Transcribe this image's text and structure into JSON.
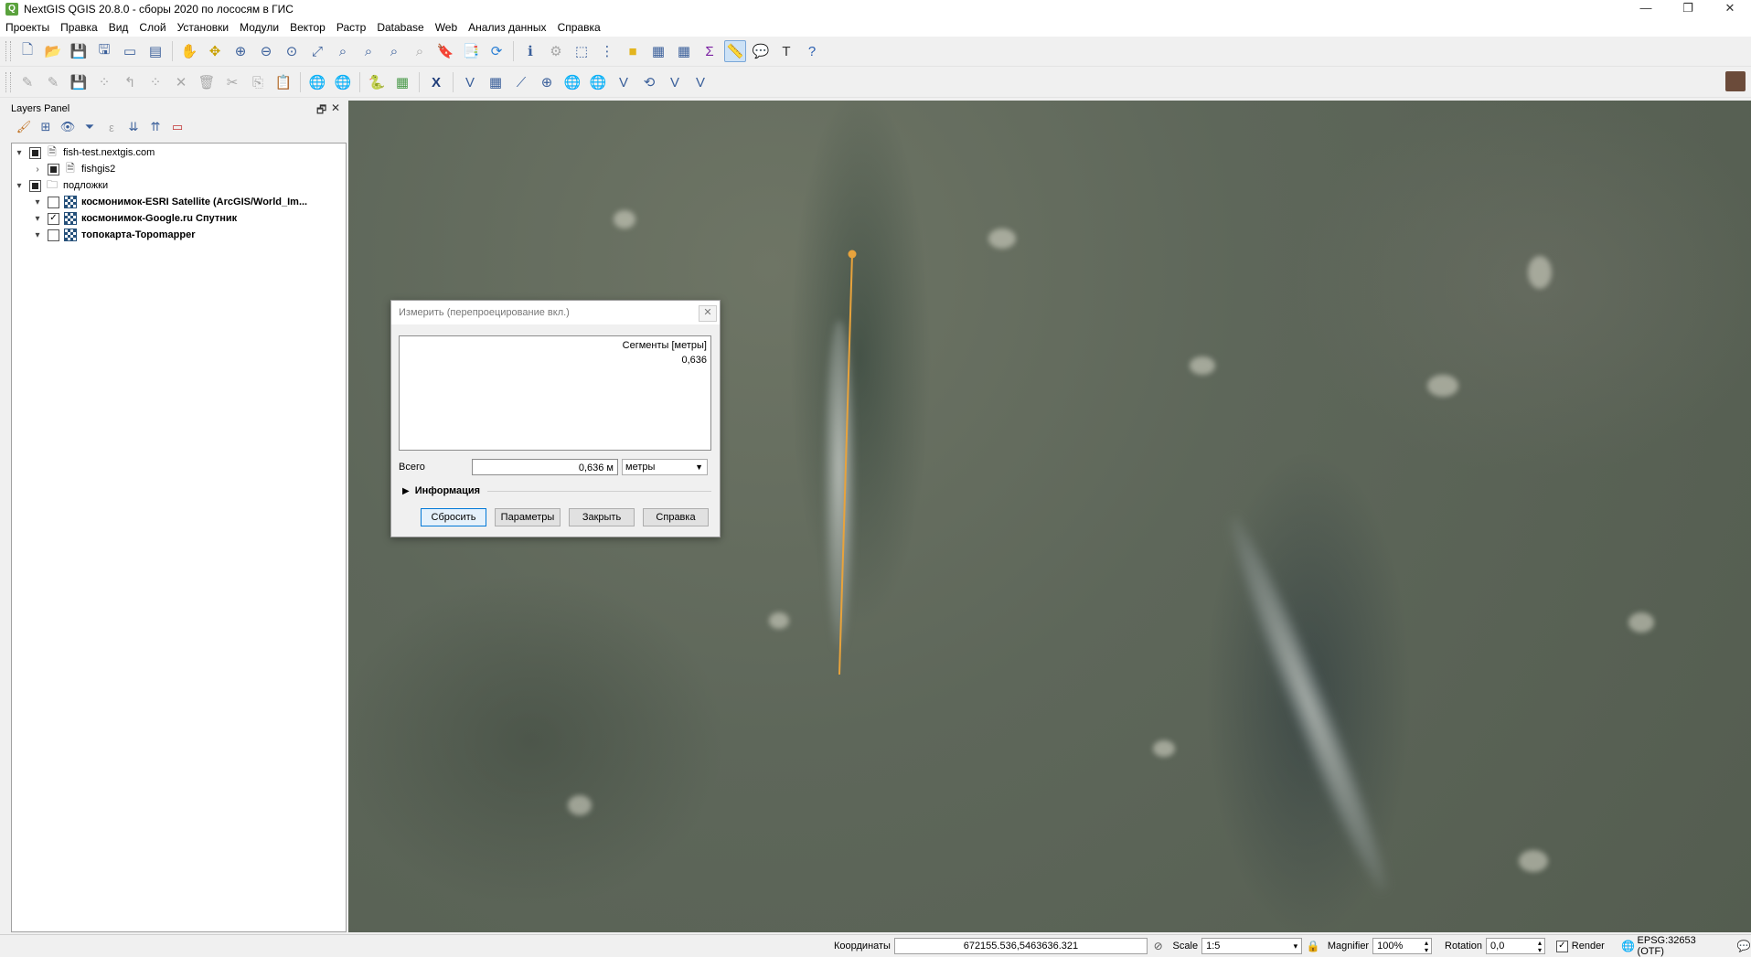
{
  "window": {
    "title": "NextGIS QGIS 20.8.0 - сборы 2020 по лососям в ГИС",
    "minimize": "—",
    "restore": "❐",
    "close": "✕"
  },
  "menu": [
    "Проекты",
    "Правка",
    "Вид",
    "Слой",
    "Установки",
    "Модули",
    "Вектор",
    "Растр",
    "Database",
    "Web",
    "Анализ данных",
    "Справка"
  ],
  "layers_panel": {
    "title": "Layers Panel",
    "float": "🗗",
    "close": "✕",
    "items": [
      {
        "label": "fish-test.nextgis.com",
        "expanded": true,
        "checked": "partial",
        "kind": "group",
        "bold": false
      },
      {
        "label": "fishgis2",
        "expanded": false,
        "checked": "partial",
        "kind": "group",
        "bold": false
      },
      {
        "label": "подложки",
        "expanded": true,
        "checked": "partial",
        "kind": "folder",
        "bold": false
      },
      {
        "label": "космонимок-ESRI Satellite (ArcGIS/World_Im...",
        "expanded": true,
        "checked": "off",
        "kind": "raster",
        "bold": true
      },
      {
        "label": "космонимок-Google.ru Спутник",
        "expanded": true,
        "checked": "on",
        "kind": "raster",
        "bold": true
      },
      {
        "label": "топокарта-Topomapper",
        "expanded": true,
        "checked": "off",
        "kind": "raster",
        "bold": true
      }
    ]
  },
  "measure_dialog": {
    "title": "Измерить (перепроецирование вкл.)",
    "close": "✕",
    "segments_header": "Сегменты [метры]",
    "segments": [
      "0,636"
    ],
    "total_label": "Всего",
    "total_value": "0,636 м",
    "units": "метры",
    "info_label": "Информация",
    "buttons": {
      "reset": "Сбросить",
      "params": "Параметры",
      "close": "Закрыть",
      "help": "Справка"
    }
  },
  "measure_line": {
    "color": "#e8a33c"
  },
  "statusbar": {
    "coords_label": "Координаты",
    "coords_value": "672155.536,5463636.321",
    "scale_label": "Scale",
    "scale_value": "1:5",
    "magnifier_label": "Magnifier",
    "magnifier_value": "100%",
    "rotation_label": "Rotation",
    "rotation_value": "0,0",
    "render_label": "Render",
    "crs": "EPSG:32653 (OTF)"
  }
}
